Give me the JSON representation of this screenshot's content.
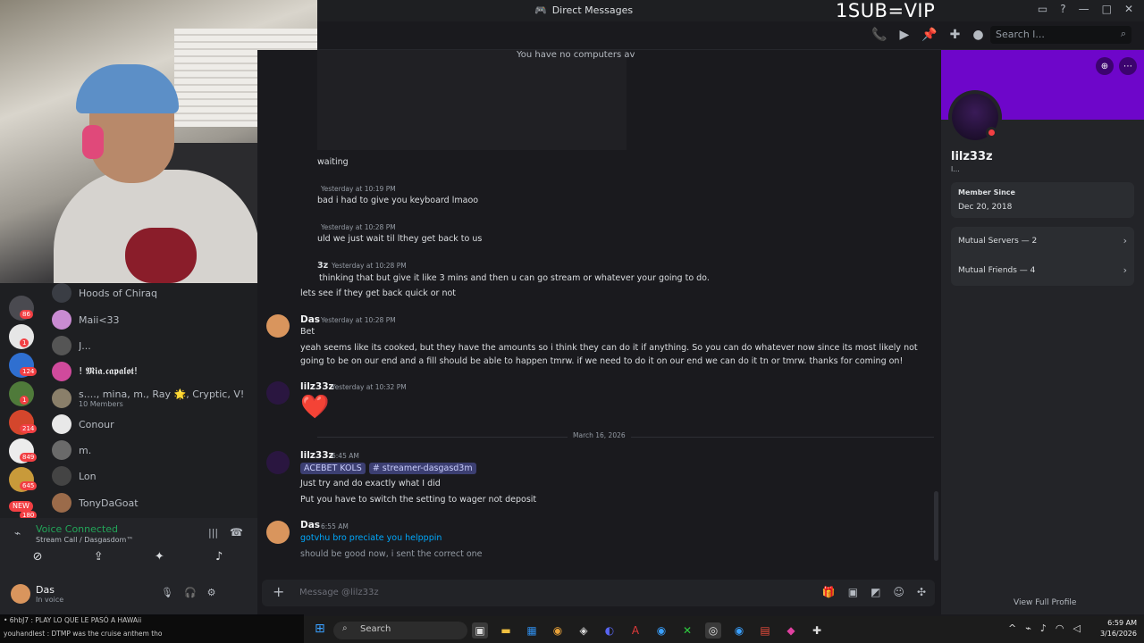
{
  "window": {
    "title": "Direct Messages",
    "overlay_text": "1SUB=VIP"
  },
  "header": {
    "search_placeholder": "Search l..."
  },
  "dm_list": [
    {
      "name": "Hoods of Chiraq",
      "sub": ""
    },
    {
      "name": "Maii<33",
      "sub": ""
    },
    {
      "name": "J...",
      "sub": ""
    },
    {
      "name": "! 𝕸𝖎𝖆.𝖈𝖆𝖕𝖆𝖑𝖔𝖙!",
      "sub": ""
    },
    {
      "name": "s...., mina, m., Ray 🌟, Cryptic, V!one, lul",
      "sub": "10 Members"
    },
    {
      "name": "Conour",
      "sub": ""
    },
    {
      "name": "m.",
      "sub": ""
    },
    {
      "name": "Lon",
      "sub": ""
    },
    {
      "name": "TonyDaGoat",
      "sub": ""
    }
  ],
  "rail_badges": [
    "86",
    "1",
    "124",
    "1",
    "214",
    "849",
    "645",
    "NEW",
    "180"
  ],
  "voice": {
    "status": "Voice Connected",
    "channel": "Stream Call / Dasgasdom™"
  },
  "user": {
    "name": "Das",
    "status": "In voice"
  },
  "chat": {
    "embed_text": "You have no computers av",
    "lines": [
      {
        "text": "waiting"
      },
      {
        "ts": "Yesterday at 10:19 PM",
        "text": "bad i had to give you keyboard lmaoo"
      },
      {
        "ts": "Yesterday at 10:28 PM",
        "text": "uld we just wait til lthey get back to us"
      },
      {
        "author_tail": "3z",
        "ts": "Yesterday at 10:28 PM",
        "text": "thinking that but give it like 3 mins and then u can go stream or whatever your going to do."
      },
      {
        "text": "lets see if they get back quick or not"
      }
    ],
    "messages": [
      {
        "author": "Das",
        "ts": "Yesterday at 10:28 PM",
        "lines": [
          "Bet",
          "yeah seems like its cooked, but they have the amounts so i think they can do it if anything. So you can do whatever now since its most likely not going to be on our end and a fill should be able to happen tmrw. if we need to do it on our end we can do it tn or tmrw. thanks for coming on!"
        ]
      },
      {
        "author": "lilz33z",
        "ts": "Yesterday at 10:32 PM",
        "lines": [
          "❤️"
        ]
      },
      {
        "author": "lilz33z",
        "ts": "6:45 AM",
        "tags": [
          "ACEBET KOLS",
          "# streamer-dasgasd3m"
        ],
        "lines": [
          "Just try and do exactly what I did",
          "Put you have to switch the setting to wager not  deposit"
        ]
      },
      {
        "author": "Das",
        "ts": "6:55 AM",
        "lines": [
          "gotvhu bro preciate you helpppin",
          "should be good now, i sent the correct one"
        ]
      }
    ],
    "date_divider": "March 16, 2026",
    "composer_placeholder": "Message @lilz33z"
  },
  "profile": {
    "name": "lilz33z",
    "tag": "l...",
    "member_since_label": "Member Since",
    "member_since": "Dec 20, 2018",
    "mutual_servers": "Mutual Servers — 2",
    "mutual_friends": "Mutual Friends — 4",
    "view_full": "View Full Profile"
  },
  "ticker": {
    "line1": "• 6hbJ7 : PLAY LO QUE LE PASÓ A HAWAii",
    "line2": "youhandlest : DTMP was the cruise anthem tho"
  },
  "taskbar": {
    "search": "Search",
    "time": "6:59 AM",
    "date": "3/16/2026"
  },
  "colors": {
    "banner": "#6e06ca",
    "online": "#23a559",
    "dnd": "#f23f43",
    "link": "#00a8fc"
  }
}
